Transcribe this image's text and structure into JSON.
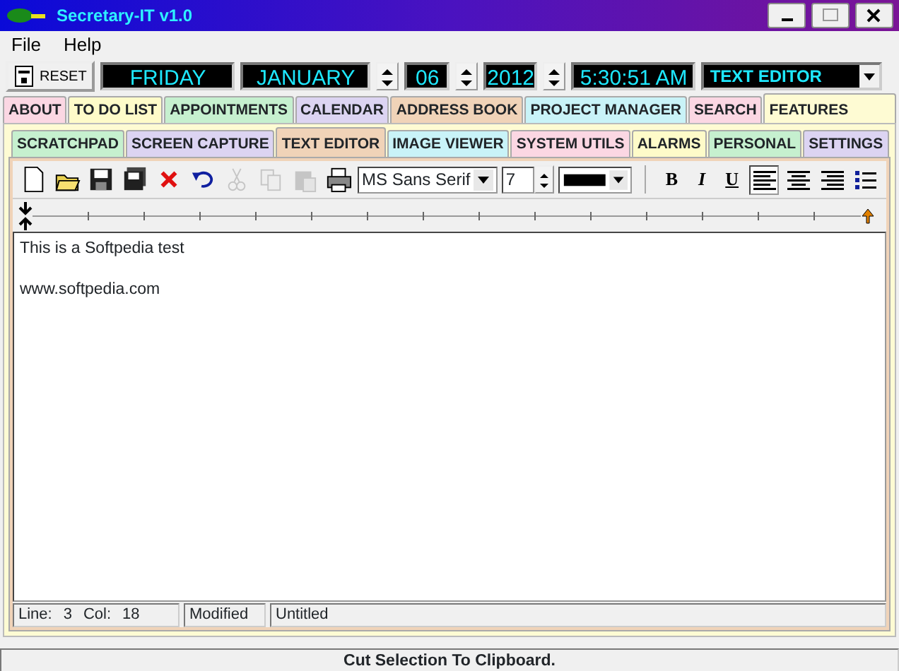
{
  "window": {
    "title": "Secretary-IT v1.0"
  },
  "menu": [
    "File",
    "Help"
  ],
  "top_bar": {
    "reset": "RESET",
    "day": "FRIDAY",
    "month": "JANUARY",
    "date": "06",
    "year": "2012",
    "time": "5:30:51 AM",
    "module": "TEXT EDITOR"
  },
  "tabs": [
    {
      "label": "ABOUT",
      "color": "#fbd7e3",
      "selected": false
    },
    {
      "label": "TO DO LIST",
      "color": "#fefbc9",
      "selected": false
    },
    {
      "label": "APPOINTMENTS",
      "color": "#c6f0cf",
      "selected": false
    },
    {
      "label": "CALENDAR",
      "color": "#dcd4f2",
      "selected": false
    },
    {
      "label": "ADDRESS BOOK",
      "color": "#f0d3b8",
      "selected": false
    },
    {
      "label": "PROJECT MANAGER",
      "color": "#c9f3f8",
      "selected": false
    },
    {
      "label": "SEARCH",
      "color": "#fbd7e3",
      "selected": false
    },
    {
      "label": "FEATURES",
      "color": "#fefbd3",
      "selected": true
    }
  ],
  "sub_tabs": [
    {
      "label": "SCRATCHPAD",
      "color": "#c6f0cf",
      "selected": false
    },
    {
      "label": "SCREEN CAPTURE",
      "color": "#dcd4f2",
      "selected": false
    },
    {
      "label": "TEXT EDITOR",
      "color": "#f0d3b8",
      "selected": true
    },
    {
      "label": "IMAGE VIEWER",
      "color": "#c9f3f8",
      "selected": false
    },
    {
      "label": "SYSTEM UTILS",
      "color": "#fbd7e3",
      "selected": false
    },
    {
      "label": "ALARMS",
      "color": "#fefbc9",
      "selected": false
    },
    {
      "label": "PERSONAL",
      "color": "#c6f0cf",
      "selected": false
    },
    {
      "label": "SETTINGS",
      "color": "#dcd4f2",
      "selected": false
    }
  ],
  "toolbar": {
    "buttons": [
      {
        "kind": "new",
        "disabled": false
      },
      {
        "kind": "open",
        "disabled": false
      },
      {
        "kind": "save",
        "disabled": false
      },
      {
        "kind": "save_all",
        "disabled": false
      },
      {
        "kind": "delete",
        "disabled": false
      },
      {
        "kind": "undo",
        "disabled": false
      },
      {
        "kind": "cut",
        "disabled": true
      },
      {
        "kind": "copy",
        "disabled": true
      },
      {
        "kind": "paste",
        "disabled": true
      },
      {
        "kind": "print",
        "disabled": false
      }
    ],
    "font": "MS Sans Serif",
    "size": "7",
    "styles": [
      {
        "kind": "bold",
        "label": "B"
      },
      {
        "kind": "italic",
        "label": "I"
      },
      {
        "kind": "underline",
        "label": "U"
      }
    ],
    "align": [
      {
        "kind": "left",
        "selected": true
      },
      {
        "kind": "center",
        "selected": false
      },
      {
        "kind": "right",
        "selected": false
      },
      {
        "kind": "bullets",
        "selected": false
      }
    ]
  },
  "document": {
    "lines": [
      "This is a Softpedia test",
      "www.softpedia.com"
    ]
  },
  "status": {
    "line_label": "Line:",
    "line": "3",
    "col_label": "Col:",
    "col": "18",
    "modified": "Modified",
    "file": "Untitled"
  },
  "hint": "Cut Selection To Clipboard."
}
